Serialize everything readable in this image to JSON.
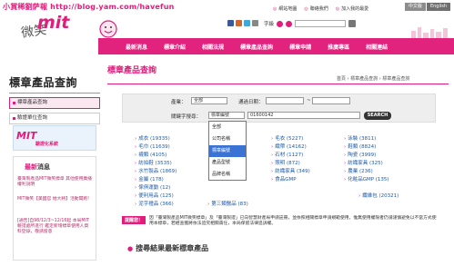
{
  "watermark": "小賞稀劉萨報 http://blog.yam.com/havefun",
  "header": {
    "lang_zh": "中文版",
    "lang_en": "English",
    "links": [
      "網站地圖",
      "聯絡我們",
      "加入我的最愛"
    ],
    "search_label": "字級",
    "logo_text": "微笑",
    "logo_mit": "mit"
  },
  "nav": {
    "items": [
      "最新消息",
      "標章介紹",
      "相關法規",
      "標章產品查詢",
      "標章申請",
      "推廣專區",
      "相關連結"
    ]
  },
  "sidebar": {
    "title": "標章產品查詢",
    "items": [
      "標章產品查詢",
      "驗證單位查詢"
    ],
    "mit_box": {
      "logo": "MIT",
      "text": "驗證化系統"
    },
    "news": {
      "title_prefix": "最新",
      "title_suffix": "消息",
      "items": [
        {
          "text": "臺灣製產品MIT微笑標章 其他使用廣播權利說明",
          "date": ""
        },
        {
          "text": "MIT微笑【美國官 她大將】活動開跑!",
          "date": ""
        },
        {
          "text": "[通告]自98/12/3~12/16起 本局MIT驗證處所進行 鑑定新增標章使用人資 料登錄，敬請留意",
          "date": ""
        }
      ]
    }
  },
  "main": {
    "title": "標章產品查詢",
    "breadcrumb": "首頁 › 標章產品查詢 › 標章產品查詢",
    "filter": {
      "industry_label": "產業：",
      "industry_value": "全部",
      "date_label": "通過日期：",
      "keyword_label": "關鍵字搜尋：",
      "keyword_type_value": "標章編號",
      "keyword_value": "01600142",
      "search_button": "SEARCH"
    },
    "dropdown_options": [
      "全部",
      "公司名稱",
      "標章編號",
      "產品型號",
      "品牌名稱"
    ],
    "dropdown_selected_index": 2,
    "categories": [
      {
        "name": "成衣",
        "count": "(19335)"
      },
      {
        "name": "毛巾",
        "count": "(11639)"
      },
      {
        "name": "襪類",
        "count": "(4105)"
      },
      {
        "name": "紡拍鞋",
        "count": "(3535)"
      },
      {
        "name": "水竹製品",
        "count": "(1869)"
      },
      {
        "name": "金屬",
        "count": "(178)"
      },
      {
        "name": "傢俱運動",
        "count": "(12)"
      },
      {
        "name": "便利用品",
        "count": "(125)"
      },
      {
        "name": "泥字禮品",
        "count": "(366)"
      },
      {
        "name": "毛衣",
        "count": "(5227)"
      },
      {
        "name": "織帶",
        "count": "(14162)"
      },
      {
        "name": "石材",
        "count": "(1127)"
      },
      {
        "name": "照明",
        "count": "(872)"
      },
      {
        "name": "紡織家具",
        "count": "(349)"
      },
      {
        "name": "食品GMP",
        "count": ""
      },
      {
        "name": "第三類醫品",
        "count": "(83)"
      },
      {
        "name": "泳裝",
        "count": "(3811)"
      },
      {
        "name": "鞋類",
        "count": "(8824)"
      },
      {
        "name": "陶瓷",
        "count": "(3999)"
      },
      {
        "name": "紡織家具",
        "count": "(325)"
      },
      {
        "name": "農業",
        "count": "(236)"
      },
      {
        "name": "化粧品GMP",
        "count": "(135)"
      },
      {
        "name": "纖維包",
        "count": "(20321)"
      }
    ],
    "notice": {
      "badge": "提醒您！",
      "text": "因「臺灣製產品MIT微笑標章」及「臺灣製證」已向智慧財產局申請註冊，並依照相關標章申請規範使用，惟無使用權限者仍請謹慎避免以不當方式使用本標章，若經查獲將依法追究相關責任，本局保留法律追訴權。"
    },
    "bottom_heading": "搜尋結果最新標章產品"
  }
}
